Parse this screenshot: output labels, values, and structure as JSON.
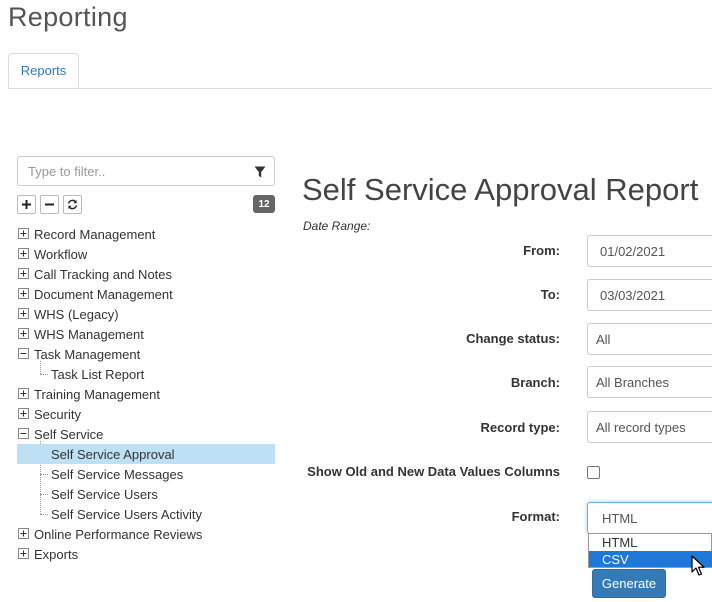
{
  "header": {
    "title": "Reporting"
  },
  "tabs": [
    {
      "label": "Reports"
    }
  ],
  "sidebar": {
    "filter_placeholder": "Type to filter..",
    "count": "12",
    "items": [
      {
        "label": "Record Management",
        "expander": "plus"
      },
      {
        "label": "Workflow",
        "expander": "plus"
      },
      {
        "label": "Call Tracking and Notes",
        "expander": "plus"
      },
      {
        "label": "Document Management",
        "expander": "plus"
      },
      {
        "label": "WHS (Legacy)",
        "expander": "plus"
      },
      {
        "label": "WHS Management",
        "expander": "plus"
      },
      {
        "label": "Task Management",
        "expander": "minus"
      },
      {
        "label": "Task List Report",
        "expander": "none"
      },
      {
        "label": "Training Management",
        "expander": "plus"
      },
      {
        "label": "Security",
        "expander": "plus"
      },
      {
        "label": "Self Service",
        "expander": "minus"
      },
      {
        "label": "Self Service Approval",
        "expander": "none",
        "selected": true
      },
      {
        "label": "Self Service Messages",
        "expander": "none"
      },
      {
        "label": "Self Service Users",
        "expander": "none"
      },
      {
        "label": "Self Service Users Activity",
        "expander": "none"
      },
      {
        "label": "Online Performance Reviews",
        "expander": "plus"
      },
      {
        "label": "Exports",
        "expander": "plus"
      }
    ]
  },
  "report": {
    "title": "Self Service Approval Report",
    "date_range_label": "Date Range:",
    "from_label": "From:",
    "from_value": "01/02/2021",
    "to_label": "To:",
    "to_value": "03/03/2021",
    "change_status_label": "Change status:",
    "change_status_value": "All",
    "branch_label": "Branch:",
    "branch_value": "All Branches",
    "record_type_label": "Record type:",
    "record_type_value": "All record types",
    "show_old_new_label": "Show Old and New Data Values Columns",
    "format_label": "Format:",
    "format_value": "HTML",
    "format_options": [
      "HTML",
      "CSV"
    ],
    "format_highlighted": "CSV",
    "generate_label": "Generate"
  }
}
